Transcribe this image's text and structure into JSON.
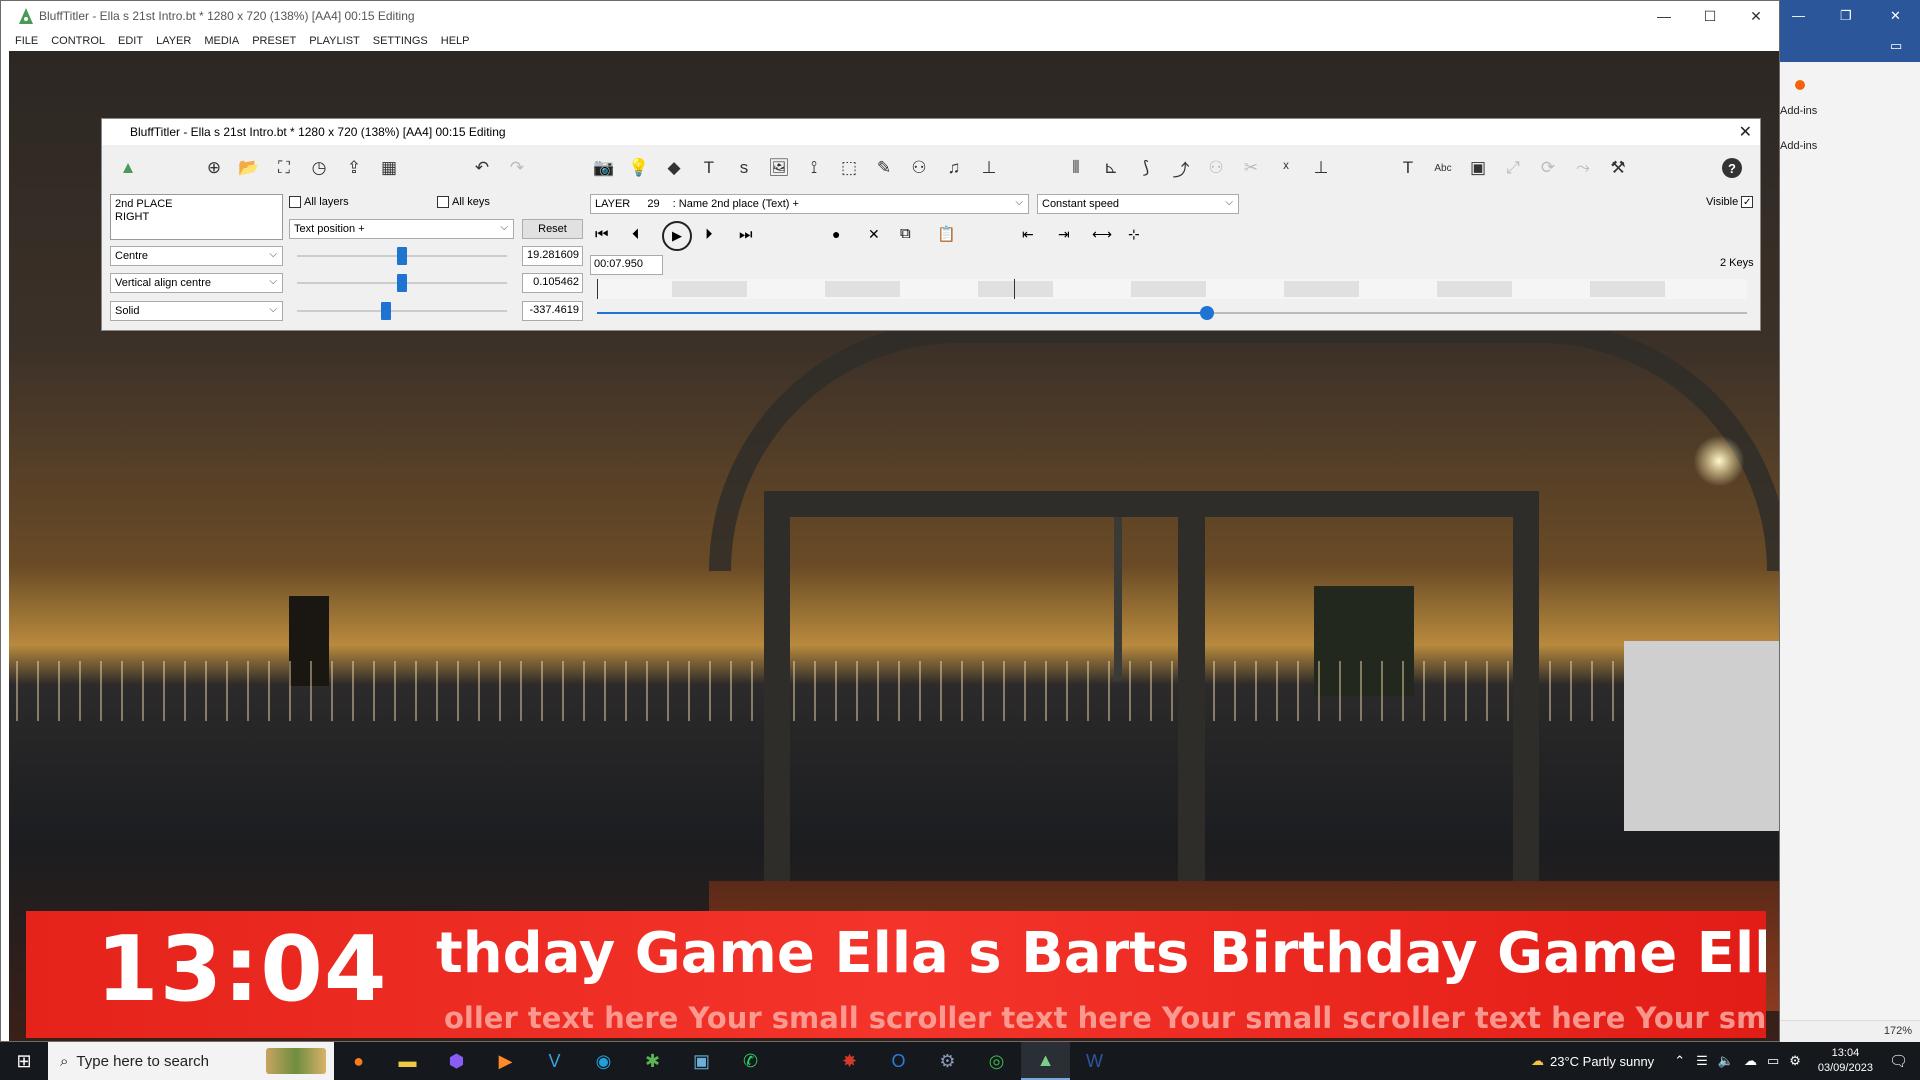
{
  "app": {
    "title": "BluffTitler - Ella s 21st Intro.bt * 1280 x 720 (138%) [AA4] 00:15 Editing",
    "menu": [
      "FILE",
      "CONTROL",
      "EDIT",
      "LAYER",
      "MEDIA",
      "PRESET",
      "PLAYLIST",
      "SETTINGS",
      "HELP"
    ]
  },
  "panel": {
    "title": "BluffTitler - Ella s 21st Intro.bt * 1280 x 720 (138%) [AA4] 00:15 Editing",
    "text_content": "2nd PLACE\nRIGHT",
    "all_layers_label": "All layers",
    "all_keys_label": "All keys",
    "property_select": "Text position +",
    "reset_label": "Reset",
    "align_select": "Centre",
    "valign_select": "Vertical align centre",
    "style_select": "Solid",
    "value_x": "19.281609",
    "value_y": "0.105462",
    "value_z": "-337.4619",
    "slider_x": 0.5,
    "slider_y": 0.5,
    "slider_z": 0.42,
    "layer_label": "LAYER",
    "layer_number": "29",
    "layer_name": ": Name 2nd place (Text) +",
    "speed_select": "Constant speed",
    "visible_label": "Visible",
    "visible_checked": "✓",
    "time_value": "00:07.950",
    "keys_label": "2 Keys",
    "playhead_fraction": 0.53
  },
  "ticker": {
    "clock": "13:04",
    "big_text": "thday Game   Ella s Barts Birthday Game   Ella",
    "small_text": "oller text here   Your small scroller text here   Your small scroller text here   Your small scr"
  },
  "word": {
    "addins_1": "Add-ins",
    "addins_2": "Add-ins",
    "zoom": "172%"
  },
  "taskbar": {
    "search_placeholder": "Type here to search",
    "weather": "23°C  Partly sunny",
    "time": "13:04",
    "date": "03/09/2023"
  },
  "colors": {
    "accent": "#1e74d0",
    "ticker_red": "#f4342a"
  }
}
